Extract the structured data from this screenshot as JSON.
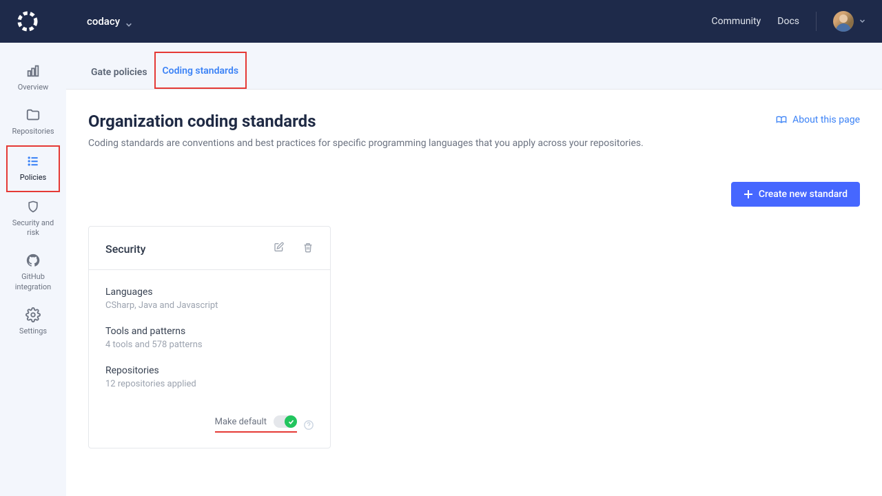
{
  "org_name": "codacy",
  "topbar": {
    "links": [
      "Community",
      "Docs"
    ]
  },
  "sidebar": {
    "items": [
      {
        "label": "Overview",
        "icon": "bar-chart-icon"
      },
      {
        "label": "Repositories",
        "icon": "folder-icon"
      },
      {
        "label": "Policies",
        "icon": "list-icon"
      },
      {
        "label": "Security and risk",
        "icon": "shield-icon"
      },
      {
        "label": "GitHub integration",
        "icon": "github-icon"
      },
      {
        "label": "Settings",
        "icon": "gear-icon"
      }
    ]
  },
  "tabs": {
    "items": [
      {
        "label": "Gate policies"
      },
      {
        "label": "Coding standards"
      }
    ],
    "active_index": 1
  },
  "page": {
    "title": "Organization coding standards",
    "description": "Coding standards are conventions and best practices for specific programming languages that you apply across your repositories.",
    "about_label": "About this page",
    "create_button": "Create new standard"
  },
  "card": {
    "title": "Security",
    "fields": [
      {
        "label": "Languages",
        "value": "CSharp, Java and Javascript"
      },
      {
        "label": "Tools and patterns",
        "value": "4 tools and 578 patterns"
      },
      {
        "label": "Repositories",
        "value": "12 repositories applied"
      }
    ],
    "make_default_label": "Make default",
    "make_default_on": true
  }
}
